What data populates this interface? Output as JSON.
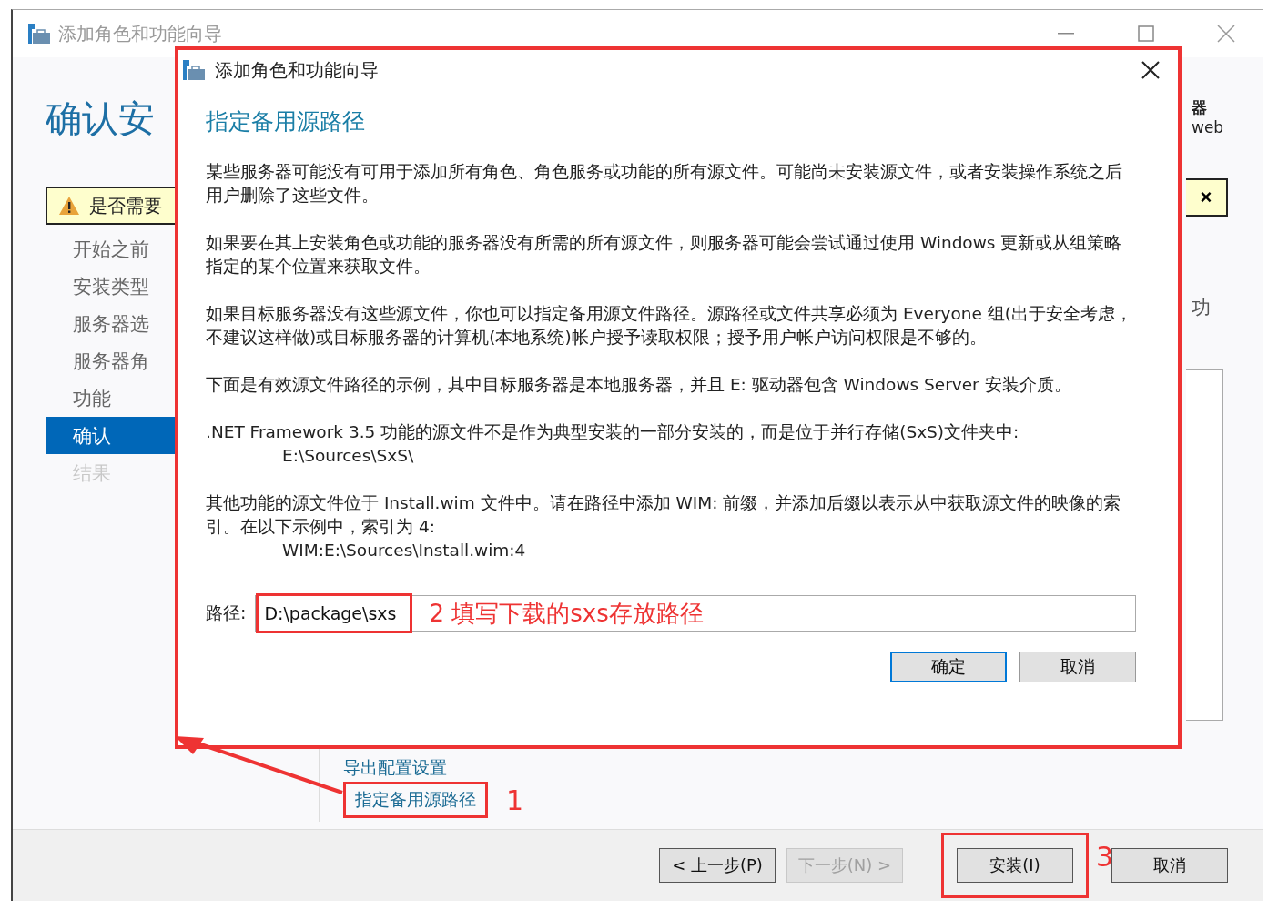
{
  "window": {
    "title": "添加角色和功能向导",
    "page_title": "确认安",
    "warning": "是否需要",
    "warning_close": "×",
    "nav": [
      {
        "label": "开始之前",
        "selected": false,
        "disabled": false
      },
      {
        "label": "安装类型",
        "selected": false,
        "disabled": false
      },
      {
        "label": "服务器选",
        "selected": false,
        "disabled": false
      },
      {
        "label": "服务器角",
        "selected": false,
        "disabled": false
      },
      {
        "label": "功能",
        "selected": false,
        "disabled": false
      },
      {
        "label": "确认",
        "selected": true,
        "disabled": false
      },
      {
        "label": "结果",
        "selected": false,
        "disabled": true
      }
    ],
    "right_texts": [
      "器",
      "web",
      "功"
    ],
    "links": [
      "导出配置设置",
      "指定备用源路径"
    ],
    "buttons": [
      {
        "label": "< 上一步(P)",
        "disabled": false
      },
      {
        "label": "下一步(N) >",
        "disabled": true
      },
      {
        "label": "安装(I)",
        "disabled": false
      },
      {
        "label": "取消",
        "disabled": false
      }
    ]
  },
  "dialog": {
    "title": "添加角色和功能向导",
    "heading": "指定备用源路径",
    "paragraphs": [
      {
        "text": "某些服务器可能没有可用于添加所有角色、角色服务或功能的所有源文件。可能尚未安装源文件，或者安装操作系统之后用户删除了这些文件。"
      },
      {
        "text": "如果要在其上安装角色或功能的服务器没有所需的所有源文件，则服务器可能会尝试通过使用 Windows 更新或从组策略指定的某个位置来获取文件。"
      },
      {
        "text": "如果目标服务器没有这些源文件，你也可以指定备用源文件路径。源路径或文件共享必须为 Everyone 组(出于安全考虑，不建议这样做)或目标服务器的计算机(本地系统)帐户授予读取权限；授予用户帐户访问权限是不够的。"
      },
      {
        "text": "下面是有效源文件路径的示例，其中目标服务器是本地服务器，并且 E: 驱动器包含 Windows Server 安装介质。"
      },
      {
        "text": ".NET Framework 3.5 功能的源文件不是作为典型安装的一部分安装的，而是位于并行存储(SxS)文件夹中:",
        "example": "E:\\Sources\\SxS\\"
      },
      {
        "text": "其他功能的源文件位于 Install.wim 文件中。请在路径中添加 WIM: 前缀，并添加后缀以表示从中获取源文件的映像的索引。在以下示例中，索引为 4:",
        "example": "WIM:E:\\Sources\\Install.wim:4"
      }
    ],
    "path_label": "路径:",
    "path_value": "D:\\package\\sxs",
    "buttons": [
      "确定",
      "取消"
    ]
  },
  "annotations": {
    "link_number": "1",
    "path_note": "2 填写下载的sxs存放路径",
    "install_number": "3"
  }
}
